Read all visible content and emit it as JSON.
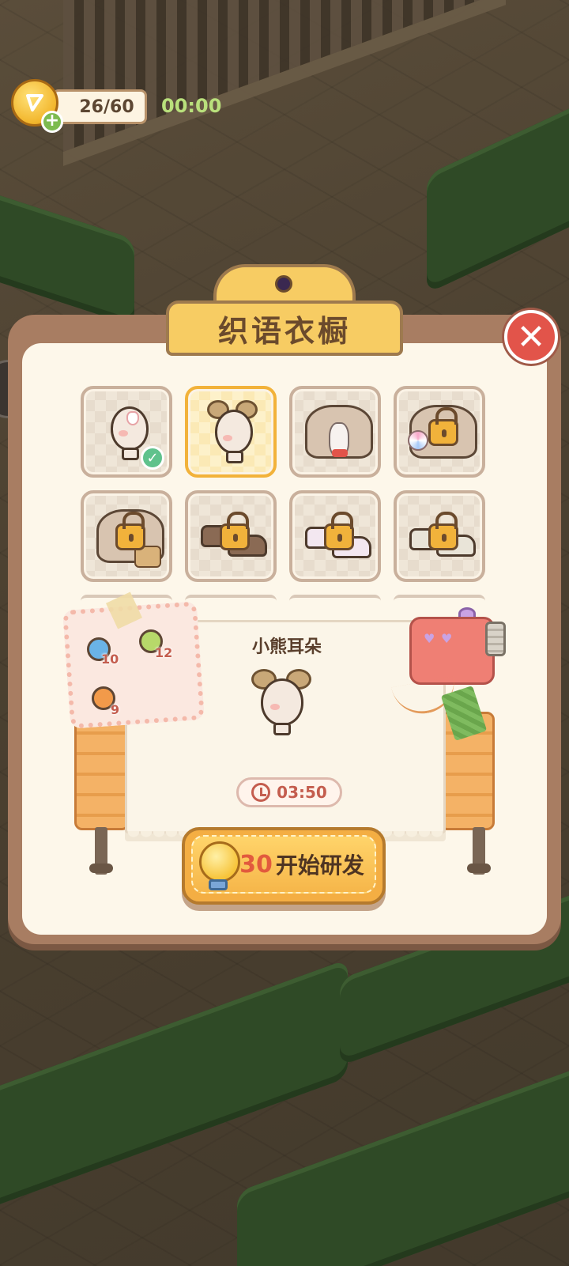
{
  "hud": {
    "energy_count": "26/60",
    "timer": "00:00"
  },
  "panel": {
    "title": "织语衣橱"
  },
  "items": [
    {
      "id": "bunny-hairpin",
      "state": "owned"
    },
    {
      "id": "bear-ears",
      "state": "selected"
    },
    {
      "id": "bunny-cape",
      "state": "available"
    },
    {
      "id": "candy-cape",
      "state": "locked"
    },
    {
      "id": "basket-cape",
      "state": "locked"
    },
    {
      "id": "brown-shoes",
      "state": "locked"
    },
    {
      "id": "bunny-slippers",
      "state": "locked"
    },
    {
      "id": "flower-shoes",
      "state": "locked"
    }
  ],
  "materials": {
    "yarn_count": "10",
    "scissors_count": "12",
    "buttons_count": "9"
  },
  "preview": {
    "item_name": "小熊耳朵",
    "craft_time": "03:50"
  },
  "start_button": {
    "cost": "30",
    "label": "开始研发"
  },
  "colors": {
    "accent_orange": "#f4ae43",
    "close_red": "#e2544a",
    "timer_green": "#b9e07c",
    "panel_bg": "#fdf7ea"
  }
}
